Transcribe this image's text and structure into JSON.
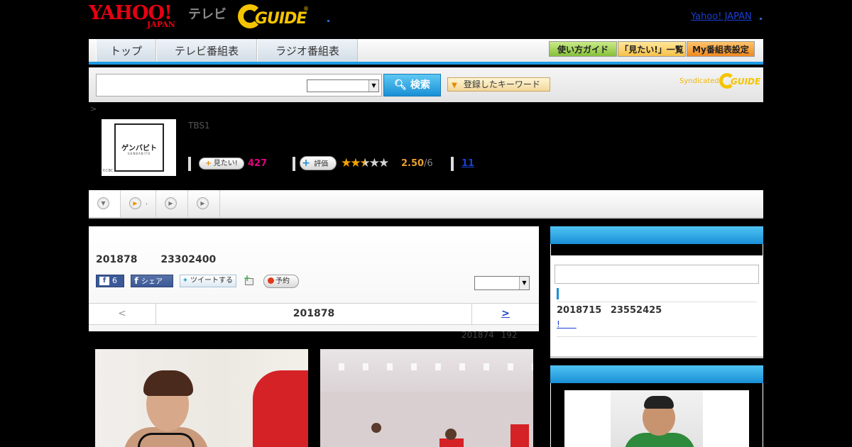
{
  "header": {
    "yahoo_logo": "YAHOO!",
    "yahoo_sub": "JAPAN",
    "tv_label": "テレビ",
    "gguide_logo": "GUIDE",
    "gguide_reg": "®",
    "yahoo_japan_link": "Yahoo! JAPAN"
  },
  "nav": {
    "tabs": [
      "トップ",
      "テレビ番組表",
      "ラジオ番組表"
    ],
    "guide_button": "使い方ガイド",
    "mitai_list_button": "「見たい!」一覧",
    "my_schedule_button": "My番組表設定"
  },
  "search": {
    "input_value": "",
    "select_value": "",
    "search_button": "検索",
    "keyword_button": "登録したキーワード",
    "syndicated": "Syndicated",
    "syndicated_logo": "GUIDE"
  },
  "breadcrumb": ">",
  "program": {
    "thumb_title": "ゲンバビト",
    "thumb_sub": "GENBABITO",
    "thumb_credit": "©CBC",
    "channel": "TBS1",
    "mitai_label": "見たい!",
    "mitai_count": "427",
    "hyoka_label": "評価",
    "rating": "2.50",
    "rating_den": "/6",
    "rating_value": 2.5,
    "review_count": "11"
  },
  "tabs_bar": {
    "tab2_label": "."
  },
  "episode": {
    "air_date": "201878 23302400",
    "fb_count": "6",
    "fb_share": "シェア",
    "tweet": "ツイートする",
    "reserve": "予約",
    "select_value": "",
    "pager_prev": "<",
    "pager_title": "201878",
    "pager_next": ">",
    "update_note": "201874 192"
  },
  "sidebar": {
    "search_value": "",
    "date": "2018715 23552425",
    "link": "!      "
  },
  "colors": {
    "accent_blue": "#1a8fd6",
    "mitai_pink": "#e4007f",
    "rating_orange": "#e8a030"
  }
}
